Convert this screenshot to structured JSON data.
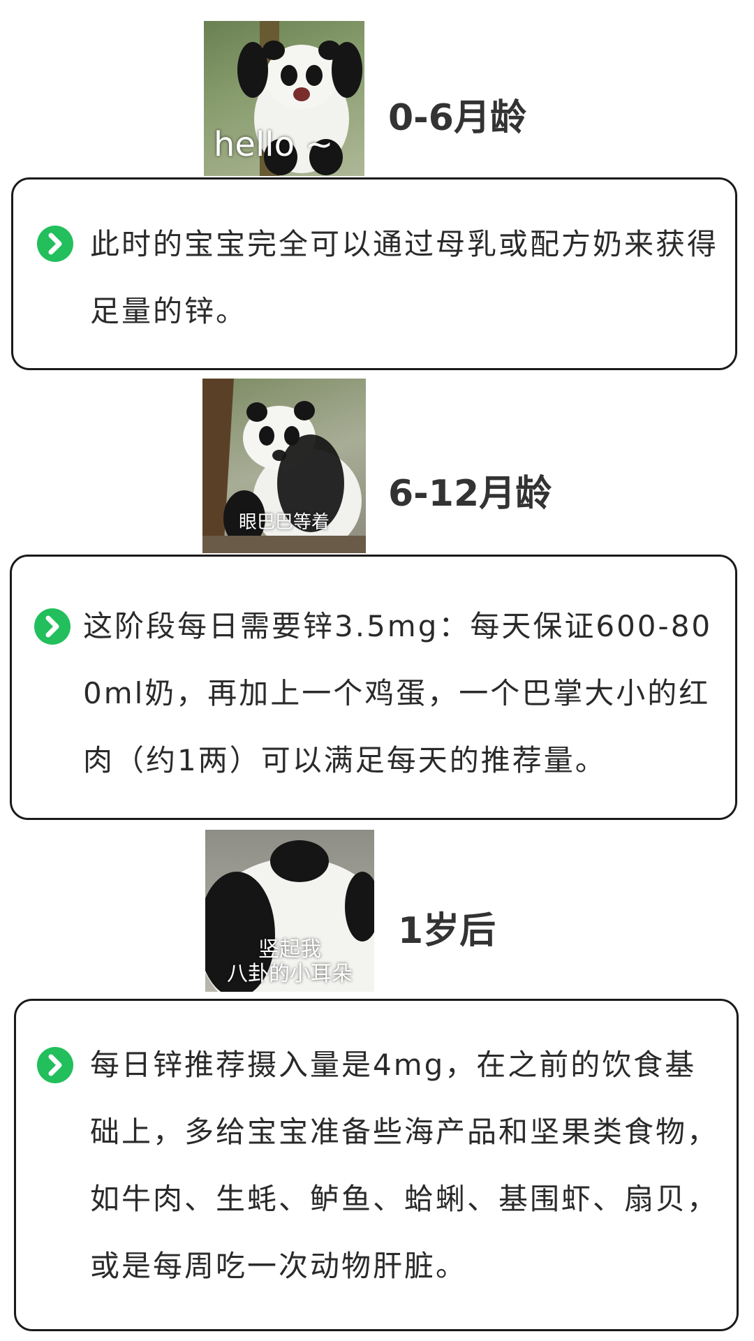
{
  "sections": [
    {
      "image_caption": "hello ~",
      "heading": "0-6月龄",
      "icon": "green-chevron-right-icon",
      "text": "此时的宝宝完全可以通过母乳或配方奶来获得足量的锌。"
    },
    {
      "image_caption": "眼巴巴等着",
      "heading": "6-12月龄",
      "icon": "green-chevron-right-icon",
      "text": "这阶段每日需要锌3.5mg：每天保证600-800ml奶，再加上一个鸡蛋，一个巴掌大小的红肉（约1两）可以满足每天的推荐量。"
    },
    {
      "image_caption_line1": "竖起我",
      "image_caption_line2": "八卦的小耳朵",
      "heading": "1岁后",
      "icon": "green-chevron-right-icon",
      "text": "每日锌推荐摄入量是4mg，在之前的饮食基础上，多给宝宝准备些海产品和坚果类食物，如牛肉、生蚝、鲈鱼、蛤蜊、基围虾、扇贝，或是每周吃一次动物肝脏。"
    }
  ],
  "colors": {
    "accent_green": "#22bf5c",
    "card_border": "#1a1a1a",
    "heading": "#333333"
  }
}
